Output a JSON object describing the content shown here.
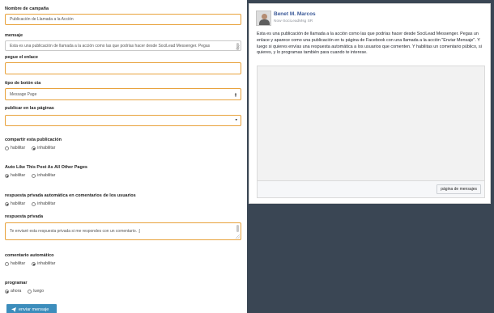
{
  "form": {
    "campaign_name": {
      "label": "Nombre de campaña",
      "value": "Publicación de Llamada a la Acción"
    },
    "message": {
      "label": "mensaje",
      "value": "Esta es una publicación de llamada a la acción como las que podrías hacer desde SociLead Messenger. Pegas"
    },
    "link": {
      "label": "pegue el enlace",
      "value": ""
    },
    "cta_type": {
      "label": "tipo de botón cta",
      "value": "Message Page"
    },
    "pages": {
      "label": "publicar en las páginas",
      "value": ""
    },
    "share_post": {
      "label": "compartir esta publicación",
      "options": [
        "habilitar",
        "inhabilitar"
      ],
      "selected": "inhabilitar"
    },
    "auto_like": {
      "label": "Auto Like This Post As All Other Pages",
      "options": [
        "habilitar",
        "inhabilitar"
      ],
      "selected": "habilitar"
    },
    "private_reply_auto": {
      "label": "respuesta privada automática en comentarios de los usuarios",
      "options": [
        "habilitar",
        "inhabilitar"
      ],
      "selected": "habilitar"
    },
    "private_reply": {
      "label": "respuesta privada",
      "value": "Te enviaré esta respuesta privada si me respondes con un comentario. ;)"
    },
    "auto_comment": {
      "label": "comentario automático",
      "options": [
        "habilitar",
        "inhabilitar"
      ],
      "selected": "inhabilitar"
    },
    "schedule": {
      "label": "programar",
      "options": [
        "ahora",
        "luego"
      ],
      "selected": "ahora"
    },
    "send_label": "enviar mensaje"
  },
  "preview": {
    "name": "Benet M. Marcos",
    "subtitle": "Now·SociLeadMsg SR",
    "body": "Esta es una publicación de llamada a la acción como las que podrías hacer desde SociLead Messenger. Pegas un enlace y aparece como una publicación en tu página de Facebook con una llamada a la acción \"Enviar Mensaje\". Y luego si quieres envías una respuesta automática a los usuarios que comenten. Y habilitas un comentario público, si quieres, y lo programas también para cuando te interese.",
    "cta_button": "página de mensajes"
  },
  "icons": {
    "send": "paper-plane-icon",
    "select_arrow": "chevron-updown-icon",
    "dropdown_arrow": "chevron-down-icon",
    "resize": "resize-handle-icon"
  },
  "colors": {
    "input_border_active": "#e8a23c",
    "primary_button": "#3c8dbc",
    "background_dark": "#3a4654",
    "facebook_name": "#3b5998"
  }
}
